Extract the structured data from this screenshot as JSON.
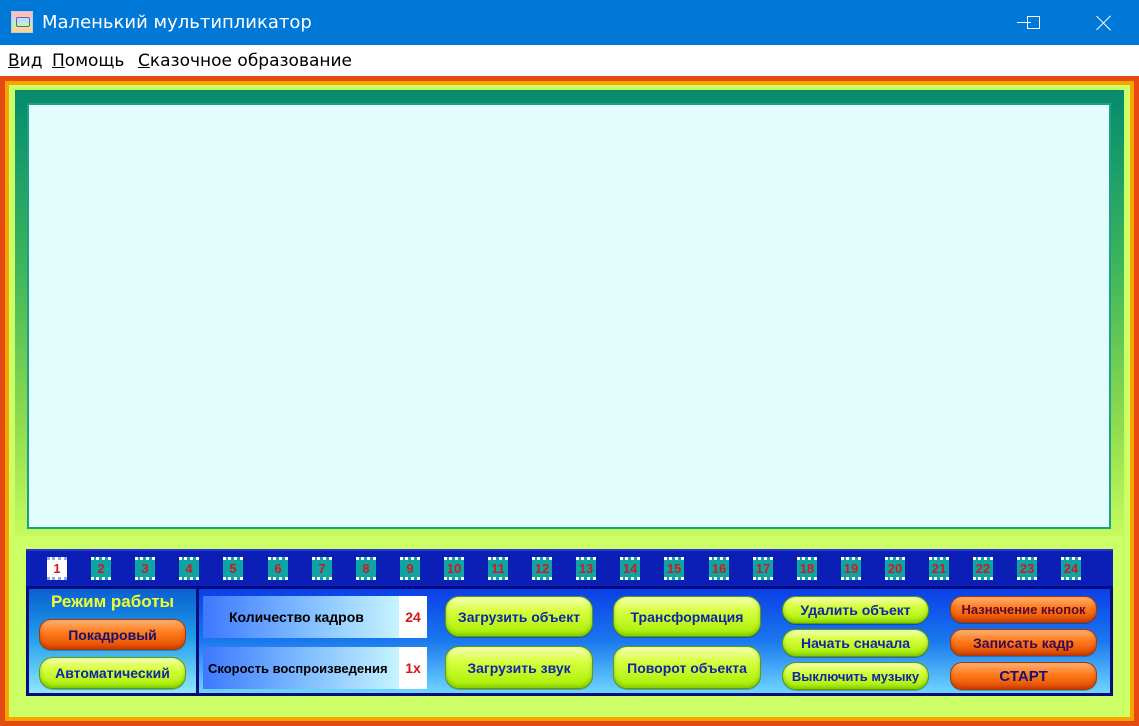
{
  "window": {
    "title": "Маленький мультипликатор"
  },
  "menu": [
    {
      "label": "Вид"
    },
    {
      "label": "Помощь"
    },
    {
      "label": "Сказочное образование"
    }
  ],
  "frames": {
    "labels": [
      "1",
      "2",
      "3",
      "4",
      "5",
      "6",
      "7",
      "8",
      "9",
      "10",
      "11",
      "12",
      "13",
      "14",
      "15",
      "16",
      "17",
      "18",
      "19",
      "20",
      "21",
      "22",
      "23",
      "24"
    ],
    "active_index": 0
  },
  "mode": {
    "title": "Режим работы",
    "frame_by_frame": "Покадровый",
    "automatic": "Автоматический"
  },
  "stats": {
    "frame_count_label": "Количество кадров",
    "frame_count_value": "24",
    "speed_label": "Скорость воспроизведения",
    "speed_value": "1x"
  },
  "buttons": {
    "load_object": "Загрузить объект",
    "load_sound": "Загрузить звук",
    "transform": "Трансформация",
    "rotate_object": "Поворот объекта",
    "delete_object": "Удалить объект",
    "start_over": "Начать сначала",
    "music_off": "Выключить музыку",
    "button_assignment": "Назначение кнопок",
    "record_frame": "Записать кадр",
    "start": "СТАРТ"
  },
  "colors": {
    "titlebar": "#0078d7",
    "canvas": "#e3fdfd",
    "film_strip": "#0b1fb6",
    "frame_number": "#d21a1a"
  }
}
